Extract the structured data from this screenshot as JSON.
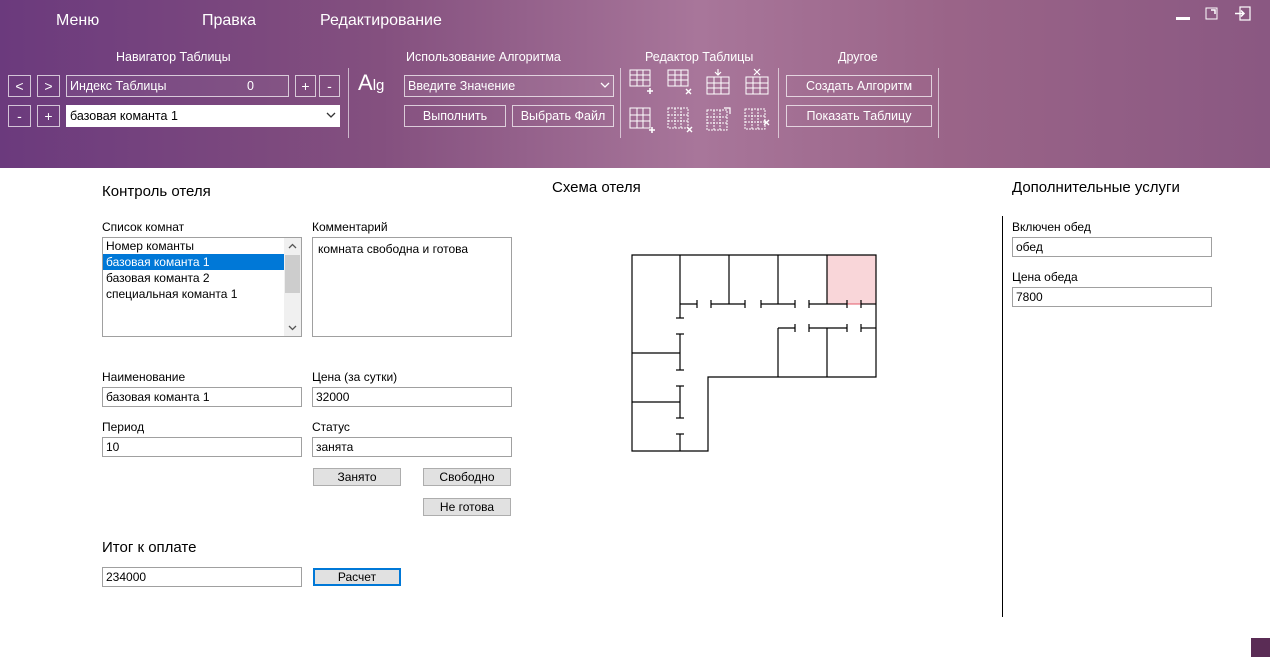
{
  "menu": {
    "items": [
      "Меню",
      "Правка",
      "Редактирование"
    ]
  },
  "ribbon": {
    "navigator": {
      "title": "Навигатор Таблицы",
      "prev": "<",
      "next": ">",
      "index_label": "Индекс Таблицы",
      "index_value": "0",
      "plus": "+",
      "minus": "-",
      "row_minus": "-",
      "row_plus": "+",
      "table_select": "базовая команта 1"
    },
    "algorithm": {
      "title": "Использование Алгоритма",
      "logo_main": "A",
      "logo_sub": "lg",
      "value_select": "Введите Значение",
      "run": "Выполнить",
      "choose_file": "Выбрать Файл"
    },
    "table_editor": {
      "title": "Редактор Таблицы"
    },
    "other": {
      "title": "Другое",
      "create_algorithm": "Создать Алгоритм",
      "show_table": "Показать Таблицу"
    }
  },
  "hotel_control": {
    "title": "Контроль отеля",
    "room_list_label": "Список комнат",
    "room_list": [
      "Номер команты",
      "базовая команта 1",
      "базовая команта 2",
      "специальная команта 1"
    ],
    "selected_index": 1,
    "comment_label": "Комментарий",
    "comment_value": "комната свободна и готова",
    "name_label": "Наименование",
    "name_value": "базовая команта 1",
    "price_label": "Цена (за сутки)",
    "price_value": "32000",
    "period_label": "Период",
    "period_value": "10",
    "status_label": "Статус",
    "status_value": "занята",
    "btn_occupied": "Занято",
    "btn_free": "Свободно",
    "btn_not_ready": "Не готова"
  },
  "total": {
    "title": "Итог к оплате",
    "value": "234000",
    "calculate": "Расчет"
  },
  "scheme": {
    "title": "Схема отеля",
    "highlight_color": "#f9d6d9"
  },
  "extra_services": {
    "title": "Дополнительные услуги",
    "lunch_label": "Включен обед",
    "lunch_value": "обед",
    "lunch_price_label": "Цена обеда",
    "lunch_price_value": "7800"
  }
}
